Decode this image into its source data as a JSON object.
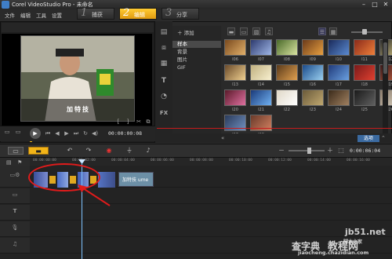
{
  "window": {
    "title": "Corel VideoStudio Pro - 未命名",
    "min": "–",
    "max": "□",
    "close": "✕"
  },
  "menu": [
    "文件",
    "编辑",
    "工具",
    "设置"
  ],
  "steps": [
    {
      "num": "1",
      "label": "捕获"
    },
    {
      "num": "2",
      "label": "编辑"
    },
    {
      "num": "3",
      "label": "分享"
    }
  ],
  "player": {
    "caption": "加特技",
    "timecode": "00:00:00:08",
    "bracket_in": "[",
    "bracket_out": "]"
  },
  "library": {
    "add_label": "添加",
    "folders": [
      "样本",
      "背景",
      "图片",
      "GIF"
    ],
    "thumb_labels": [
      "I06",
      "I07",
      "I08",
      "I09",
      "I10",
      "I11",
      "I12",
      "I13",
      "I14",
      "I15",
      "I16",
      "I17",
      "I18",
      "I19",
      "I20",
      "I21",
      "I22",
      "I23",
      "I24",
      "I25",
      "I26",
      "I27",
      "I28"
    ],
    "browse_label": "浏览",
    "options_label": "选项"
  },
  "timeline": {
    "ruler": [
      "00:00:00:00",
      "00:00:02:00",
      "00:00:04:00",
      "00:00:06:00",
      "00:00:08:00",
      "00:00:10:00",
      "00:00:12:00",
      "00:00:14:00",
      "00:00:16:00"
    ],
    "duration": "0:00:06:04",
    "title_clip": "加特技 ume"
  },
  "watermark": {
    "site": "jb51.net",
    "brand": "脚本之家",
    "cn": "查字典",
    "cn2": "教程网",
    "url": "jiaocheng.chazidian.com"
  },
  "colors": {
    "accent": "#f2b418",
    "highlight": "#e01b1b",
    "playhead": "#7fc3ff"
  }
}
